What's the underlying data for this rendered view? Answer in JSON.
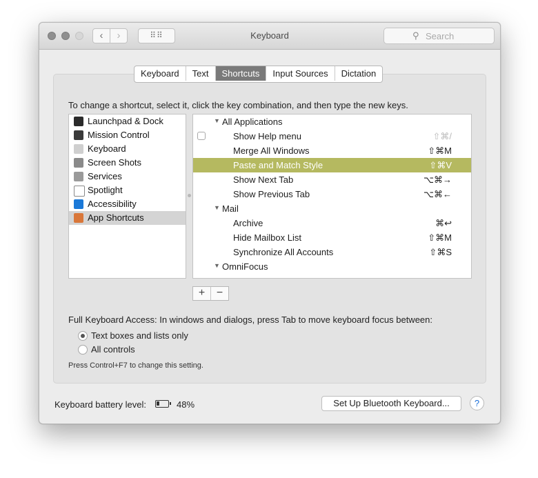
{
  "window": {
    "title": "Keyboard"
  },
  "toolbar": {
    "back_glyph": "‹",
    "forward_glyph": "›",
    "grid_glyph": "⠿⠿",
    "search_placeholder": "Search"
  },
  "tabs": [
    {
      "label": "Keyboard",
      "active": false
    },
    {
      "label": "Text",
      "active": false
    },
    {
      "label": "Shortcuts",
      "active": true
    },
    {
      "label": "Input Sources",
      "active": false
    },
    {
      "label": "Dictation",
      "active": false
    }
  ],
  "instructions": "To change a shortcut, select it, click the key combination, and then type the new keys.",
  "categories": [
    {
      "label": "Launchpad & Dock",
      "icon": "launchpad-icon",
      "color": "#2b2b2b"
    },
    {
      "label": "Mission Control",
      "icon": "mission-control-icon",
      "color": "#3a3a3a"
    },
    {
      "label": "Keyboard",
      "icon": "keyboard-icon",
      "color": "#cfcfcf"
    },
    {
      "label": "Screen Shots",
      "icon": "screenshot-icon",
      "color": "#8a8a8a"
    },
    {
      "label": "Services",
      "icon": "gear-icon",
      "color": "#9a9a9a"
    },
    {
      "label": "Spotlight",
      "icon": "spotlight-icon",
      "color": "#ffffff"
    },
    {
      "label": "Accessibility",
      "icon": "accessibility-icon",
      "color": "#1b79d8"
    },
    {
      "label": "App Shortcuts",
      "icon": "app-shortcuts-icon",
      "color": "#d9773a",
      "selected": true
    }
  ],
  "shortcuts": [
    {
      "kind": "group",
      "label": "All Applications"
    },
    {
      "kind": "item",
      "label": "Show Help menu",
      "keys": "⇧⌘/",
      "checkbox": true,
      "dim": true
    },
    {
      "kind": "item",
      "label": "Merge All Windows",
      "keys": "⇧⌘M"
    },
    {
      "kind": "item",
      "label": "Paste and Match Style",
      "keys": "⇧⌘V",
      "highlight": true
    },
    {
      "kind": "item",
      "label": "Show Next Tab",
      "keys": "⌥⌘→"
    },
    {
      "kind": "item",
      "label": "Show Previous Tab",
      "keys": "⌥⌘←"
    },
    {
      "kind": "group",
      "label": "Mail"
    },
    {
      "kind": "item",
      "label": "Archive",
      "keys": "⌘↩"
    },
    {
      "kind": "item",
      "label": "Hide Mailbox List",
      "keys": "⇧⌘M"
    },
    {
      "kind": "item",
      "label": "Synchronize All Accounts",
      "keys": "⇧⌘S"
    },
    {
      "kind": "group",
      "label": "OmniFocus"
    }
  ],
  "list_buttons": {
    "add": "+",
    "remove": "−"
  },
  "full_keyboard_access": {
    "label": "Full Keyboard Access: In windows and dialogs, press Tab to move keyboard focus between:",
    "options": [
      {
        "label": "Text boxes and lists only",
        "selected": true
      },
      {
        "label": "All controls",
        "selected": false
      }
    ],
    "note": "Press Control+F7 to change this setting."
  },
  "battery": {
    "label": "Keyboard battery level:",
    "percent": "48%"
  },
  "bluetooth_button": "Set Up Bluetooth Keyboard...",
  "help_glyph": "?"
}
